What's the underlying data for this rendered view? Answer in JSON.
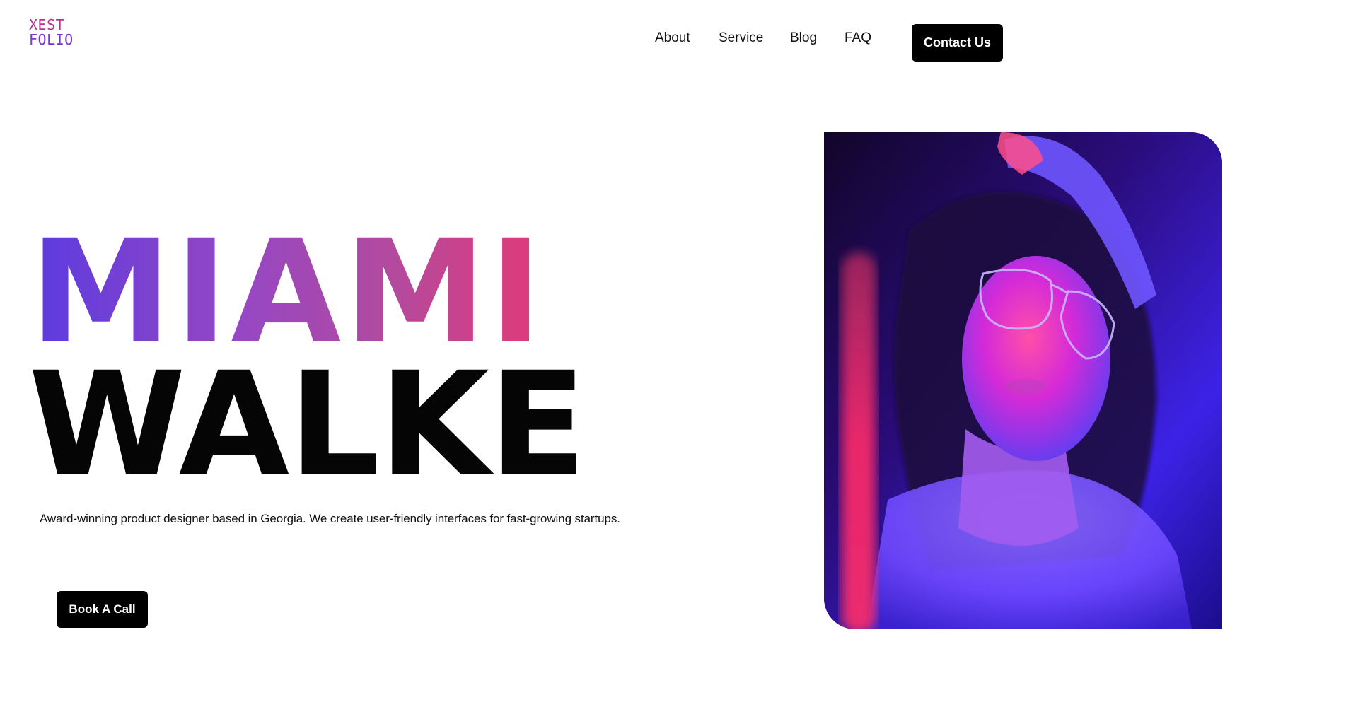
{
  "brand": {
    "logo_line1": "XEST",
    "logo_line2": "FOLIO"
  },
  "nav": {
    "items": [
      {
        "label": "About"
      },
      {
        "label": "Service"
      },
      {
        "label": "Blog"
      },
      {
        "label": "FAQ"
      }
    ],
    "contact_label": "Contact Us"
  },
  "hero": {
    "first_name": "MIAMI",
    "last_name": "WALKE",
    "description": "Award-winning product designer based in Georgia. We create user-friendly interfaces for fast-growing startups.",
    "cta_label": "Book A Call",
    "photo": "portrait-neon-glasses"
  },
  "colors": {
    "gradient_start": "#5b3be0",
    "gradient_end": "#e23a78",
    "button_bg": "#000000",
    "logo_pink": "#b0348e",
    "logo_purple": "#7a36c8"
  }
}
